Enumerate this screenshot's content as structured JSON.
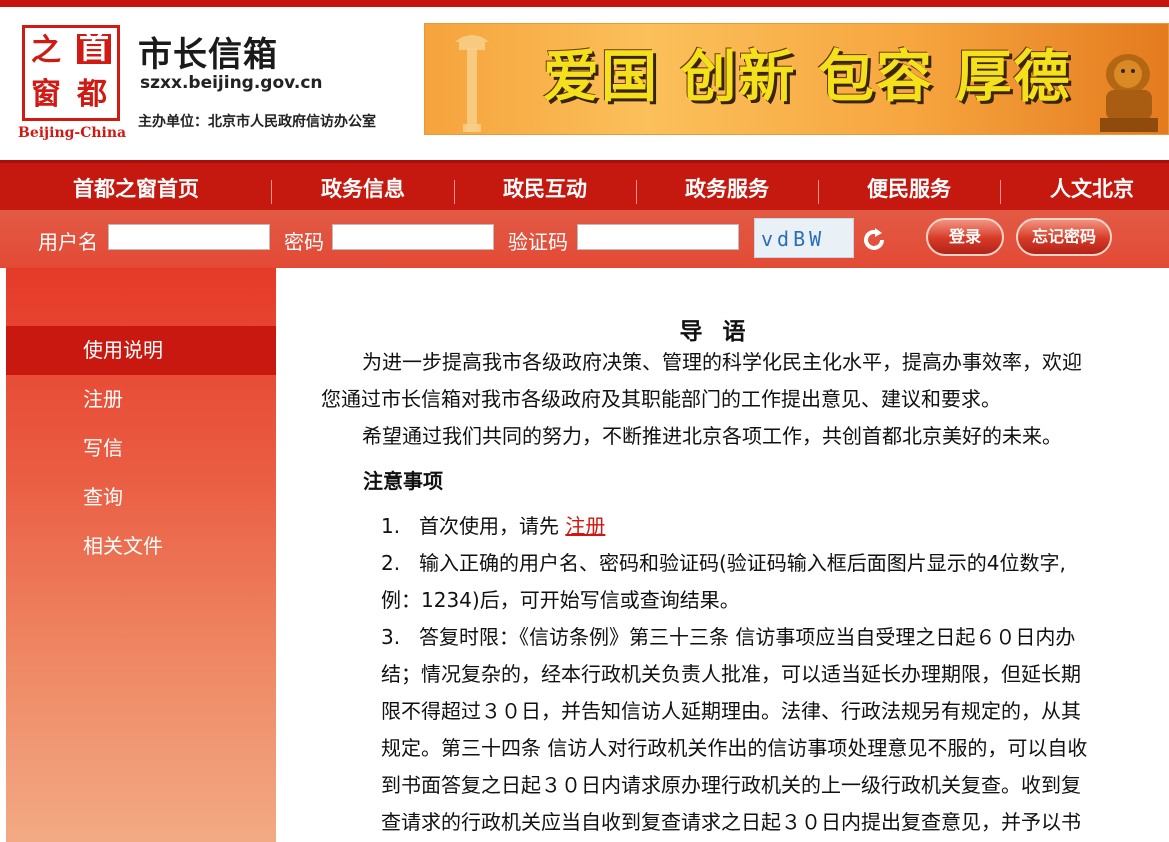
{
  "header": {
    "title": "市长信箱",
    "url": "szxx.beijing.gov.cn",
    "host": "主办单位：北京市人民政府信访办公室",
    "logo": {
      "chars": [
        "之",
        "首",
        "窗",
        "都"
      ],
      "english": "Beijing-China"
    },
    "banner_text": "爱国 创新 包容 厚德"
  },
  "nav": {
    "items": [
      "首都之窗首页",
      "政务信息",
      "政民互动",
      "政务服务",
      "便民服务",
      "人文北京"
    ]
  },
  "login": {
    "username_label": "用户名",
    "password_label": "密码",
    "captcha_label": "验证码",
    "captcha_text": "vdBW",
    "login_button": "登录",
    "forgot_button": "忘记密码"
  },
  "sidebar": {
    "items": [
      "使用说明",
      "注册",
      "写信",
      "查询",
      "相关文件"
    ],
    "active_index": 0
  },
  "main": {
    "heading": "导语",
    "intro_line1": "为进一步提高我市各级政府决策、管理的科学化民主化水平，提高办事效率，欢迎",
    "intro_line2": "您通过市长信箱对我市各级政府及其职能部门的工作提出意见、建议和要求。",
    "intro_line3": "希望通过我们共同的努力，不断推进北京各项工作，共创首都北京美好的未来。",
    "notes_heading": "注意事项",
    "notes": [
      {
        "num": "1.",
        "text": "首次使用，请先",
        "link": "注册"
      },
      {
        "num": "2.",
        "lines": [
          "输入正确的用户名、密码和验证码(验证码输入框后面图片显示的4位数字,",
          "例：1234)后，可开始写信或查询结果。"
        ]
      },
      {
        "num": "3.",
        "lines": [
          "答复时限：《信访条例》第三十三条 信访事项应当自受理之日起６０日内办",
          "结；情况复杂的，经本行政机关负责人批准，可以适当延长办理期限，但延长期",
          "限不得超过３０日，并告知信访人延期理由。法律、行政法规另有规定的，从其",
          "规定。第三十四条 信访人对行政机关作出的信访事项处理意见不服的，可以自收",
          "到书面答复之日起３０日内请求原办理行政机关的上一级行政机关复查。收到复",
          "查请求的行政机关应当自收到复查请求之日起３０日内提出复查意见，并予以书"
        ]
      }
    ]
  },
  "colors": {
    "nav_red": "#c5180f",
    "login_red": "#e34a35",
    "link_red": "#d0160f",
    "sidebar_active": "#c8180f"
  }
}
